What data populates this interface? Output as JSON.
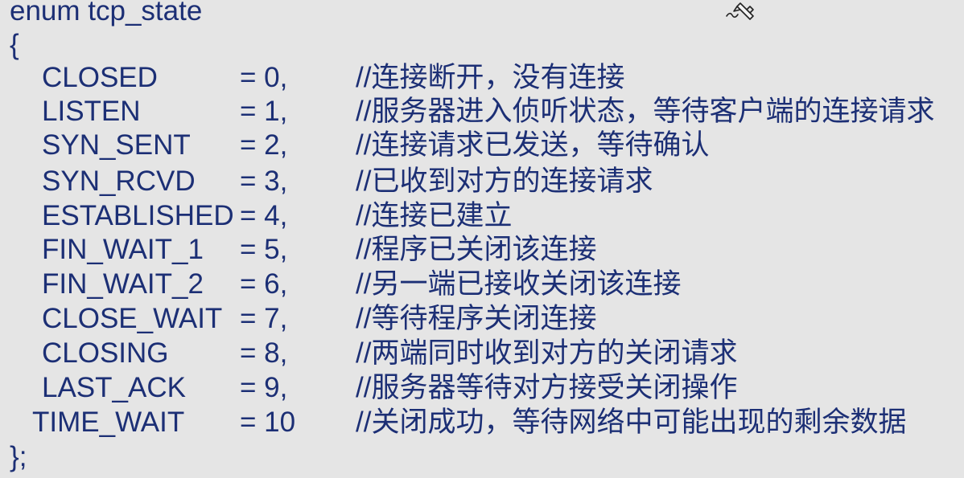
{
  "code": {
    "header": "enum tcp_state",
    "open_brace": "{",
    "close_brace": "};",
    "entries": [
      {
        "name": "CLOSED",
        "value": "= 0,",
        "comment": "//连接断开，没有连接"
      },
      {
        "name": "LISTEN",
        "value": "= 1,",
        "comment": "//服务器进入侦听状态，等待客户端的连接请求"
      },
      {
        "name": "SYN_SENT",
        "value": "= 2,",
        "comment": "//连接请求已发送，等待确认"
      },
      {
        "name": "SYN_RCVD",
        "value": "= 3,",
        "comment": "//已收到对方的连接请求"
      },
      {
        "name": "ESTABLISHED",
        "value": "= 4,",
        "comment": "//连接已建立"
      },
      {
        "name": "FIN_WAIT_1",
        "value": "= 5,",
        "comment": "//程序已关闭该连接"
      },
      {
        "name": "FIN_WAIT_2",
        "value": "= 6,",
        "comment": "//另一端已接收关闭该连接"
      },
      {
        "name": "CLOSE_WAIT",
        "value": "= 7,",
        "comment": "//等待程序关闭连接"
      },
      {
        "name": "CLOSING",
        "value": "= 8,",
        "comment": "//两端同时收到对方的关闭请求"
      },
      {
        "name": "LAST_ACK",
        "value": "= 9,",
        "comment": "//服务器等待对方接受关闭操作"
      },
      {
        "name": "TIME_WAIT",
        "value": "= 10",
        "comment": "//关闭成功，等待网络中可能出现的剩余数据"
      }
    ]
  },
  "icons": {
    "cursor": "pen-cursor-icon"
  },
  "colors": {
    "background": "#e5e5e5",
    "text": "#1c2f75"
  }
}
